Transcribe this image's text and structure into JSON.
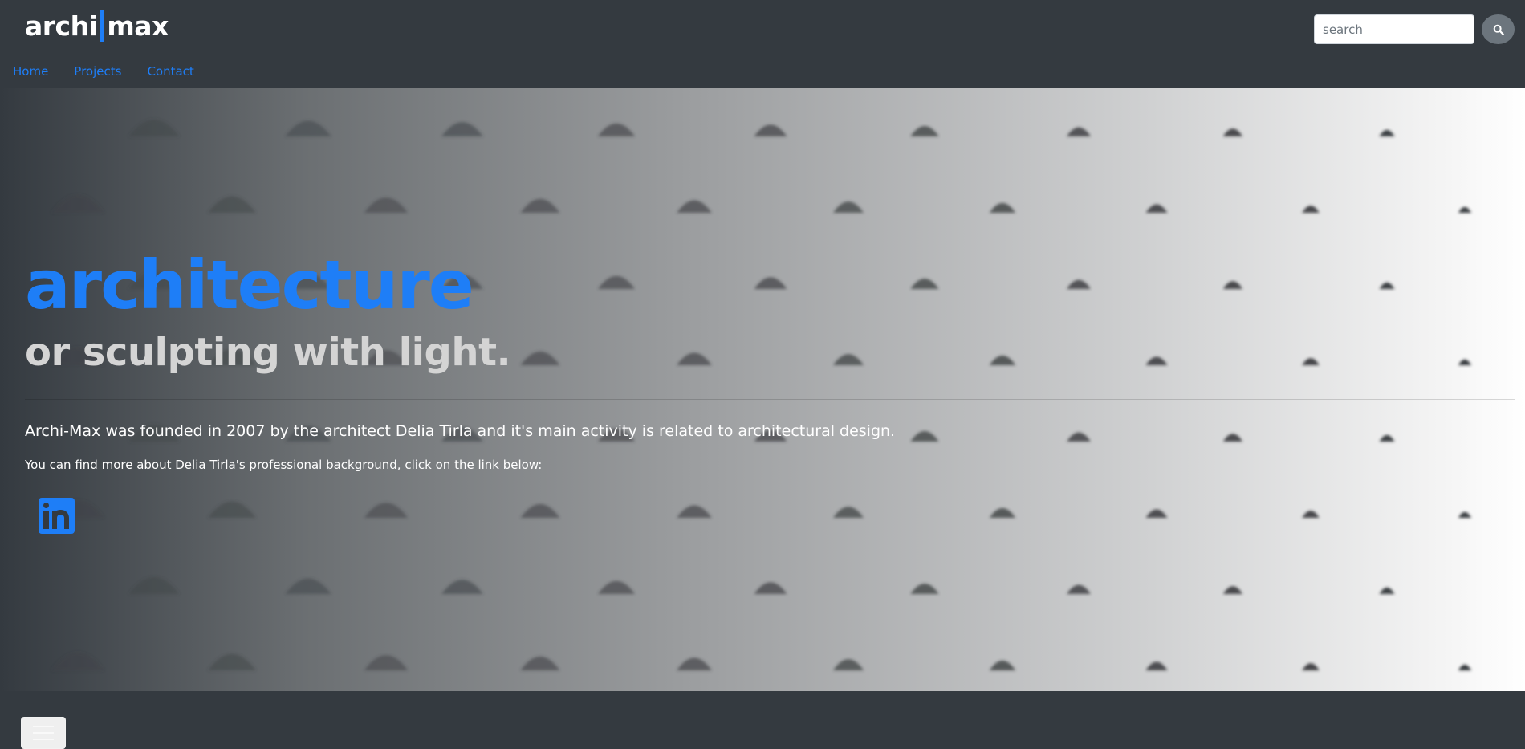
{
  "brand": {
    "part1": "archi",
    "part2": "max"
  },
  "search": {
    "placeholder": "search",
    "button_icon": "search-icon"
  },
  "nav": {
    "items": [
      {
        "label": "Home"
      },
      {
        "label": "Projects"
      },
      {
        "label": "Contact"
      }
    ]
  },
  "hero": {
    "title": "architecture",
    "subtitle": "or sculpting with light.",
    "lead": "Archi-Max was founded in 2007 by the architect Delia Tirla and it's main activity is related to architectural design.",
    "text": "You can find more about Delia Tirla's professional background, click on the link below:",
    "social_icon": "linkedin-icon"
  },
  "footer": {
    "menu_icon": "hamburger-menu-icon"
  },
  "colors": {
    "accent": "#1e7ef7",
    "background": "#343a40",
    "muted": "#6c757d"
  }
}
